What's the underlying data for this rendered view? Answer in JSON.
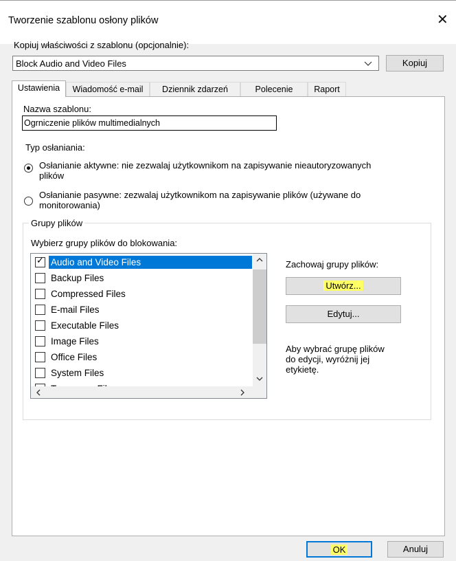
{
  "window": {
    "title": "Tworzenie szablonu osłony plików",
    "close_glyph": "✕"
  },
  "copy_from": {
    "label": "Kopiuj właściwości z szablonu (opcjonalnie):",
    "selected": "Block Audio and Video Files",
    "copy_button": "Kopiuj"
  },
  "tabs": [
    {
      "label": "Ustawienia",
      "active": true
    },
    {
      "label": "Wiadomość e-mail"
    },
    {
      "label": "Dziennik zdarzeń"
    },
    {
      "label": "Polecenie"
    },
    {
      "label": "Raport"
    }
  ],
  "settings": {
    "name_label": "Nazwa szablonu:",
    "name_value": "Ogrniczenie plików multimedialnych",
    "screening_type_label": "Typ osłaniania:",
    "active_line1": "Osłanianie aktywne: nie zezwalaj użytkownikom na zapisywanie nieautoryzowanych",
    "active_line2": "plików",
    "passive_line1": "Osłanianie pasywne: zezwalaj użytkownikom na zapisywanie plików (używane do",
    "passive_line2": "monitorowania)",
    "screening_selected": "active"
  },
  "file_groups": {
    "group_title": "Grupy plików",
    "select_label": "Wybierz grupy plików do blokowania:",
    "items": [
      {
        "label": "Audio and Video Files",
        "checked": true,
        "selected": true
      },
      {
        "label": "Backup Files",
        "checked": false
      },
      {
        "label": "Compressed Files",
        "checked": false
      },
      {
        "label": "E-mail Files",
        "checked": false
      },
      {
        "label": "Executable Files",
        "checked": false
      },
      {
        "label": "Image Files",
        "checked": false
      },
      {
        "label": "Office Files",
        "checked": false
      },
      {
        "label": "System Files",
        "checked": false
      },
      {
        "label": "Temporary Files",
        "checked": false
      }
    ],
    "maintain_label": "Zachowaj grupy plików:",
    "create_button": "Utwórz...",
    "edit_button": "Edytuj...",
    "hint_line1": "Aby wybrać grupę plików",
    "hint_line2": "do edycji, wyróżnij jej",
    "hint_line3": "etykietę."
  },
  "footer": {
    "ok_button": "OK",
    "cancel_button": "Anuluj"
  },
  "colors": {
    "selection": "#0078d7",
    "highlight": "#ffff66"
  },
  "icons": [
    "close-icon",
    "chevron-down-icon",
    "checkmark-icon",
    "scroll-up-icon",
    "scroll-down-icon",
    "scroll-left-icon",
    "scroll-right-icon"
  ]
}
